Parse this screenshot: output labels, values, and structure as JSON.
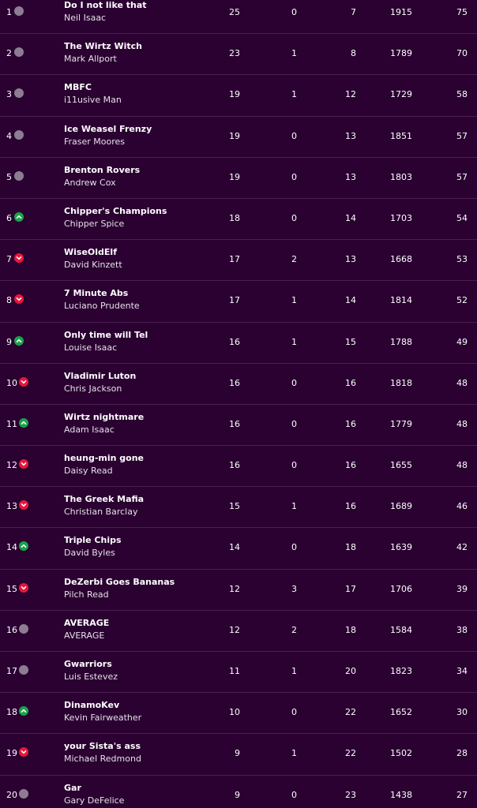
{
  "colors": {
    "background": "#2a0131",
    "divider": "#4a1f52",
    "movement_same": "#8e7d92",
    "movement_up": "#1aa34a",
    "movement_down": "#e6173d"
  },
  "rows": [
    {
      "rank": "1",
      "movement": "same",
      "movement_icon": "neutral-dot-icon",
      "team": "Do I not like that",
      "manager": "Neil Isaac",
      "w": "25",
      "d": "0",
      "l": "7",
      "pf": "1915",
      "pts": "75"
    },
    {
      "rank": "2",
      "movement": "same",
      "movement_icon": "neutral-dot-icon",
      "team": "The Wirtz Witch",
      "manager": "Mark Allport",
      "w": "23",
      "d": "1",
      "l": "8",
      "pf": "1789",
      "pts": "70"
    },
    {
      "rank": "3",
      "movement": "same",
      "movement_icon": "neutral-dot-icon",
      "team": "MBFC",
      "manager": "i11usive Man",
      "w": "19",
      "d": "1",
      "l": "12",
      "pf": "1729",
      "pts": "58"
    },
    {
      "rank": "4",
      "movement": "same",
      "movement_icon": "neutral-dot-icon",
      "team": "Ice Weasel Frenzy",
      "manager": "Fraser Moores",
      "w": "19",
      "d": "0",
      "l": "13",
      "pf": "1851",
      "pts": "57"
    },
    {
      "rank": "5",
      "movement": "same",
      "movement_icon": "neutral-dot-icon",
      "team": "Brenton Rovers",
      "manager": "Andrew Cox",
      "w": "19",
      "d": "0",
      "l": "13",
      "pf": "1803",
      "pts": "57"
    },
    {
      "rank": "6",
      "movement": "up",
      "movement_icon": "arrow-up-icon",
      "team": "Chipper's Champions",
      "manager": "Chipper Spice",
      "w": "18",
      "d": "0",
      "l": "14",
      "pf": "1703",
      "pts": "54"
    },
    {
      "rank": "7",
      "movement": "down",
      "movement_icon": "arrow-down-icon",
      "team": "WiseOldElf",
      "manager": "David Kinzett",
      "w": "17",
      "d": "2",
      "l": "13",
      "pf": "1668",
      "pts": "53"
    },
    {
      "rank": "8",
      "movement": "down",
      "movement_icon": "arrow-down-icon",
      "team": "7 Minute Abs",
      "manager": "Luciano Prudente",
      "w": "17",
      "d": "1",
      "l": "14",
      "pf": "1814",
      "pts": "52"
    },
    {
      "rank": "9",
      "movement": "up",
      "movement_icon": "arrow-up-icon",
      "team": "Only time will Tel",
      "manager": "Louise Isaac",
      "w": "16",
      "d": "1",
      "l": "15",
      "pf": "1788",
      "pts": "49"
    },
    {
      "rank": "10",
      "movement": "down",
      "movement_icon": "arrow-down-icon",
      "team": "Vladimir Luton",
      "manager": "Chris Jackson",
      "w": "16",
      "d": "0",
      "l": "16",
      "pf": "1818",
      "pts": "48"
    },
    {
      "rank": "11",
      "movement": "up",
      "movement_icon": "arrow-up-icon",
      "team": "Wirtz nightmare",
      "manager": "Adam Isaac",
      "w": "16",
      "d": "0",
      "l": "16",
      "pf": "1779",
      "pts": "48"
    },
    {
      "rank": "12",
      "movement": "down",
      "movement_icon": "arrow-down-icon",
      "team": "heung-min gone",
      "manager": "Daisy Read",
      "w": "16",
      "d": "0",
      "l": "16",
      "pf": "1655",
      "pts": "48"
    },
    {
      "rank": "13",
      "movement": "down",
      "movement_icon": "arrow-down-icon",
      "team": "The Greek Mafia",
      "manager": "Christian Barclay",
      "w": "15",
      "d": "1",
      "l": "16",
      "pf": "1689",
      "pts": "46"
    },
    {
      "rank": "14",
      "movement": "up",
      "movement_icon": "arrow-up-icon",
      "team": "Triple Chips",
      "manager": "David Byles",
      "w": "14",
      "d": "0",
      "l": "18",
      "pf": "1639",
      "pts": "42"
    },
    {
      "rank": "15",
      "movement": "down",
      "movement_icon": "arrow-down-icon",
      "team": "DeZerbi Goes Bananas",
      "manager": "Pilch Read",
      "w": "12",
      "d": "3",
      "l": "17",
      "pf": "1706",
      "pts": "39"
    },
    {
      "rank": "16",
      "movement": "same",
      "movement_icon": "neutral-dot-icon",
      "team": "AVERAGE",
      "manager": "AVERAGE",
      "w": "12",
      "d": "2",
      "l": "18",
      "pf": "1584",
      "pts": "38"
    },
    {
      "rank": "17",
      "movement": "same",
      "movement_icon": "neutral-dot-icon",
      "team": "Gwarriors",
      "manager": "Luis Estevez",
      "w": "11",
      "d": "1",
      "l": "20",
      "pf": "1823",
      "pts": "34"
    },
    {
      "rank": "18",
      "movement": "up",
      "movement_icon": "arrow-up-icon",
      "team": "DinamoKev",
      "manager": "Kevin Fairweather",
      "w": "10",
      "d": "0",
      "l": "22",
      "pf": "1652",
      "pts": "30"
    },
    {
      "rank": "19",
      "movement": "down",
      "movement_icon": "arrow-down-icon",
      "team": "your Sista's ass",
      "manager": "Michael Redmond",
      "w": "9",
      "d": "1",
      "l": "22",
      "pf": "1502",
      "pts": "28"
    },
    {
      "rank": "20",
      "movement": "same",
      "movement_icon": "neutral-dot-icon",
      "team": "Gar",
      "manager": "Gary DeFelice",
      "w": "9",
      "d": "0",
      "l": "23",
      "pf": "1438",
      "pts": "27"
    }
  ]
}
